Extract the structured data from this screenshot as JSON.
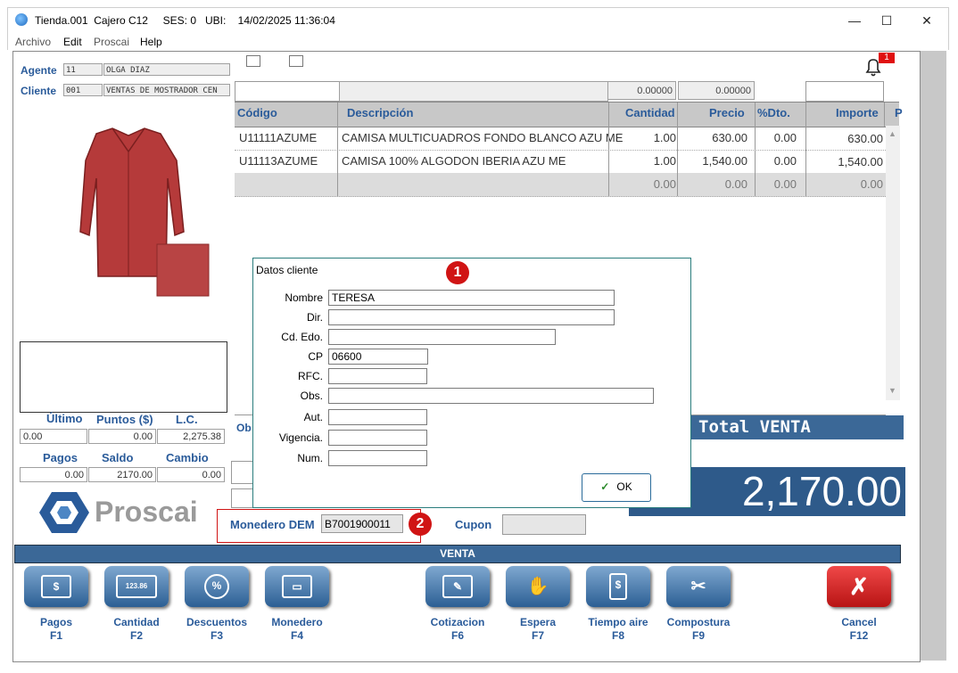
{
  "window": {
    "title": "Tienda.001  Cajero C12     SES: 0   UBI:    14/02/2025 11:36:04",
    "min": "—",
    "max": "☐",
    "close": "✕"
  },
  "menu": [
    "Archivo",
    "Edit",
    "Proscai",
    "Help"
  ],
  "agent": {
    "label": "Agente",
    "code": "11",
    "name": "OLGA DIAZ"
  },
  "client": {
    "label": "Cliente",
    "code": "001",
    "name": "VENTAS DE MOSTRADOR CEN"
  },
  "notification": {
    "count": "1"
  },
  "grid": {
    "top_inputs": [
      "0.00000",
      "0.00000"
    ],
    "headers": [
      "Código",
      "Descripción",
      "Cantidad",
      "Precio",
      "%Dto.",
      "Importe",
      "P"
    ],
    "rows": [
      {
        "code": "U11111AZUME",
        "desc": "CAMISA MULTICUADROS FONDO BLANCO AZU ME",
        "qty": "1.00",
        "price": "630.00",
        "dto": "0.00",
        "amount": "630.00"
      },
      {
        "code": "U11113AZUME",
        "desc": "CAMISA 100% ALGODON IBERIA AZU ME",
        "qty": "1.00",
        "price": "1,540.00",
        "dto": "0.00",
        "amount": "1,540.00"
      },
      {
        "code": "",
        "desc": "",
        "qty": "0.00",
        "price": "0.00",
        "dto": "0.00",
        "amount": "0.00"
      }
    ]
  },
  "stats": {
    "ultimo_label": "Último",
    "puntos_label": "Puntos ($)",
    "lc_label": "L.C.",
    "ultimo": "0.00",
    "puntos": "0.00",
    "lc": "2,275.38",
    "pagos_label": "Pagos",
    "saldo_label": "Saldo",
    "cambio_label": "Cambio",
    "pagos": "0.00",
    "saldo": "2170.00",
    "cambio": "0.00"
  },
  "brand": {
    "name": "Proscai"
  },
  "obs_partial": "Ob",
  "total": {
    "label": "Total VENTA",
    "value": "2,170.00"
  },
  "monedero": {
    "label": "Monedero DEM",
    "value": "B7001900011",
    "badge": "2"
  },
  "cupon": {
    "label": "Cupon"
  },
  "dialog": {
    "title": "Datos cliente",
    "badge": "1",
    "fields": [
      {
        "label": "Nombre",
        "value": "TERESA"
      },
      {
        "label": "Dir.",
        "value": ""
      },
      {
        "label": "Cd. Edo.",
        "value": ""
      },
      {
        "label": "CP",
        "value": "06600"
      },
      {
        "label": "RFC.",
        "value": ""
      },
      {
        "label": "Obs.",
        "value": ""
      },
      {
        "label": "Aut.",
        "value": ""
      },
      {
        "label": "Vigencia.",
        "value": ""
      },
      {
        "label": "Num.",
        "value": ""
      }
    ],
    "ok": "OK"
  },
  "venta_bar": "VENTA",
  "fkeys": [
    {
      "label": "Pagos",
      "key": "F1",
      "icon": "$"
    },
    {
      "label": "Cantidad",
      "key": "F2",
      "icon": "123.86"
    },
    {
      "label": "Descuentos",
      "key": "F3",
      "icon": "%"
    },
    {
      "label": "Monedero",
      "key": "F4",
      "icon": "▭"
    },
    {
      "label": "Cotizacion",
      "key": "F6",
      "icon": "✎"
    },
    {
      "label": "Espera",
      "key": "F7",
      "icon": "✋"
    },
    {
      "label": "Tiempo aire",
      "key": "F8",
      "icon": "$"
    },
    {
      "label": "Compostura",
      "key": "F9",
      "icon": "✂"
    },
    {
      "label": "Cancel",
      "key": "F12",
      "icon": "✗"
    }
  ]
}
